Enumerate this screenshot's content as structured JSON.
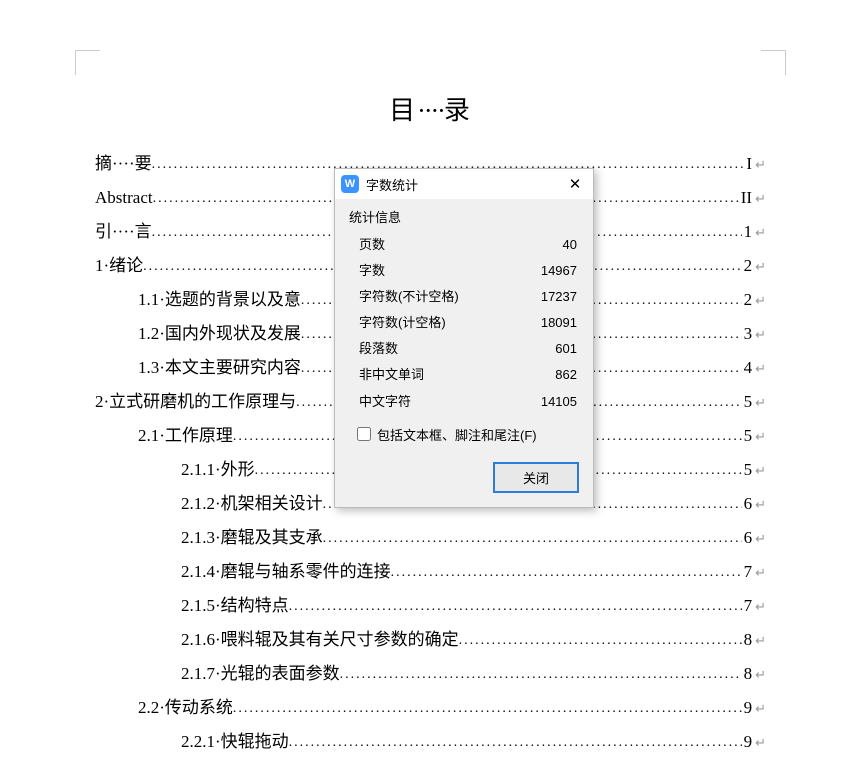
{
  "title_parts": {
    "left": "目",
    "dots": "····",
    "right": "录"
  },
  "toc": [
    {
      "indent": 0,
      "text": "摘····要",
      "page": "I",
      "end": "↵"
    },
    {
      "indent": 0,
      "text": "Abstract",
      "page": "II",
      "end": "↵"
    },
    {
      "indent": 0,
      "text": "引····言",
      "page": "1",
      "end": "↵"
    },
    {
      "indent": 0,
      "text": "1·绪论",
      "page": "2",
      "end": "↵"
    },
    {
      "indent": 1,
      "text": "1.1·选题的背景以及意",
      "page": "2",
      "end": "↵"
    },
    {
      "indent": 1,
      "text": "1.2·国内外现状及发展",
      "page": "3",
      "end": "↵"
    },
    {
      "indent": 1,
      "text": "1.3·本文主要研究内容",
      "page": "4",
      "end": "↵"
    },
    {
      "indent": 0,
      "text": "2·立式研磨机的工作原理与",
      "page": "5",
      "end": "↵"
    },
    {
      "indent": 1,
      "text": "2.1·工作原理",
      "page": "5",
      "end": "↵"
    },
    {
      "indent": 2,
      "text": "2.1.1·外形",
      "page": "5",
      "end": "↵"
    },
    {
      "indent": 2,
      "text": "2.1.2·机架相关设计",
      "page": "6",
      "end": "↵"
    },
    {
      "indent": 2,
      "text": "2.1.3·磨辊及其支承",
      "page": "6",
      "end": "↵"
    },
    {
      "indent": 2,
      "text": "2.1.4·磨辊与轴系零件的连接",
      "page": "7",
      "end": "↵"
    },
    {
      "indent": 2,
      "text": "2.1.5·结构特点",
      "page": "7",
      "end": "↵"
    },
    {
      "indent": 2,
      "text": "2.1.6·喂料辊及其有关尺寸参数的确定",
      "page": "8",
      "end": "↵"
    },
    {
      "indent": 2,
      "text": "2.1.7·光辊的表面参数",
      "page": "8",
      "end": "↵"
    },
    {
      "indent": 1,
      "text": "2.2·传动系统",
      "page": "9",
      "end": "↵"
    },
    {
      "indent": 2,
      "text": "2.2.1·快辊拖动",
      "page": "9",
      "end": "↵"
    }
  ],
  "dialog": {
    "title": "字数统计",
    "section_title": "统计信息",
    "stats": [
      {
        "label": "页数",
        "value": "40"
      },
      {
        "label": "字数",
        "value": "14967"
      },
      {
        "label": "字符数(不计空格)",
        "value": "17237"
      },
      {
        "label": "字符数(计空格)",
        "value": "18091"
      },
      {
        "label": "段落数",
        "value": "601"
      },
      {
        "label": "非中文单词",
        "value": "862"
      },
      {
        "label": "中文字符",
        "value": "14105"
      }
    ],
    "checkbox_label": "包括文本框、脚注和尾注(F)",
    "close_button": "关闭"
  }
}
